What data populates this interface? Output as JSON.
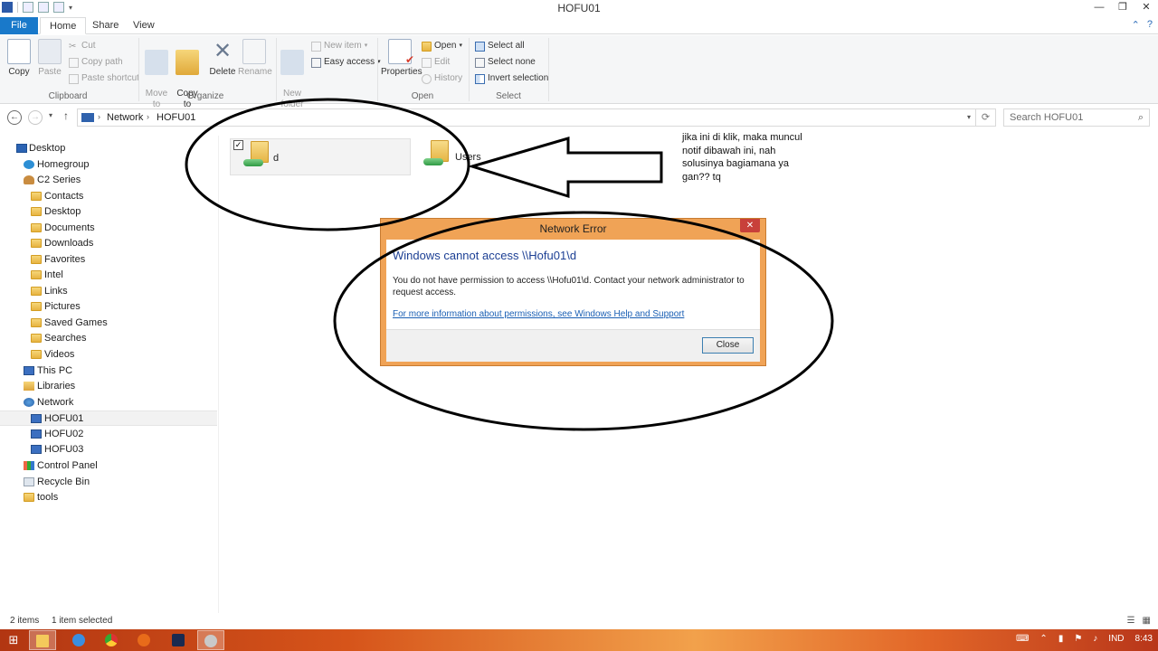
{
  "window": {
    "title": "HOFU01"
  },
  "ribbon_tabs": {
    "file": "File",
    "home": "Home",
    "share": "Share",
    "view": "View"
  },
  "ribbon": {
    "copy": "Copy",
    "paste": "Paste",
    "cut": "Cut",
    "copy_path": "Copy path",
    "paste_shortcut": "Paste shortcut",
    "clipboard_group": "Clipboard",
    "move_to": "Move\nto",
    "copy_to": "Copy\nto",
    "delete": "Delete",
    "rename": "Rename",
    "organize_group": "Organize",
    "new_folder": "New\nfolder",
    "new_item": "New item",
    "easy_access": "Easy access",
    "properties": "Properties",
    "open": "Open",
    "edit": "Edit",
    "history": "History",
    "open_group": "Open",
    "select_all": "Select all",
    "select_none": "Select none",
    "invert_selection": "Invert selection",
    "select_group": "Select"
  },
  "address": {
    "crumbs": [
      "Network",
      "HOFU01"
    ],
    "search_placeholder": "Search HOFU01"
  },
  "nav": {
    "items": [
      {
        "label": "Desktop",
        "icon": "desktop-icon"
      },
      {
        "label": "Homegroup",
        "icon": "homegroup-icon"
      },
      {
        "label": "C2 Series",
        "icon": "user-icon"
      },
      {
        "label": "Contacts",
        "icon": "folder-icon"
      },
      {
        "label": "Desktop",
        "icon": "folder-icon"
      },
      {
        "label": "Documents",
        "icon": "folder-icon"
      },
      {
        "label": "Downloads",
        "icon": "folder-icon"
      },
      {
        "label": "Favorites",
        "icon": "folder-icon"
      },
      {
        "label": "Intel",
        "icon": "folder-icon"
      },
      {
        "label": "Links",
        "icon": "folder-icon"
      },
      {
        "label": "Pictures",
        "icon": "folder-icon"
      },
      {
        "label": "Saved Games",
        "icon": "folder-icon"
      },
      {
        "label": "Searches",
        "icon": "folder-icon"
      },
      {
        "label": "Videos",
        "icon": "folder-icon"
      },
      {
        "label": "This PC",
        "icon": "pc-icon"
      },
      {
        "label": "Libraries",
        "icon": "libraries-icon"
      },
      {
        "label": "Network",
        "icon": "network-icon"
      },
      {
        "label": "HOFU01",
        "icon": "computer-icon"
      },
      {
        "label": "HOFU02",
        "icon": "computer-icon"
      },
      {
        "label": "HOFU03",
        "icon": "computer-icon"
      },
      {
        "label": "Control Panel",
        "icon": "control-panel-icon"
      },
      {
        "label": "Recycle Bin",
        "icon": "recycle-bin-icon"
      },
      {
        "label": "tools",
        "icon": "folder-icon"
      }
    ]
  },
  "content": {
    "items": [
      {
        "name": "d",
        "selected": true
      },
      {
        "name": "Users",
        "selected": false
      }
    ]
  },
  "annotation": {
    "note": "jika ini di klik, maka muncul notif dibawah ini, nah solusinya bagiamana ya gan?? tq"
  },
  "dialog": {
    "title": "Network Error",
    "heading": "Windows cannot access \\\\Hofu01\\d",
    "message": "You do not have permission to access \\\\Hofu01\\d. Contact your network administrator to request access.",
    "link": "For more information about permissions, see Windows Help and Support",
    "close_button": "Close"
  },
  "status": {
    "count": "2 items",
    "selection": "1 item selected"
  },
  "taskbar": {
    "language": "IND",
    "time": "8:43"
  },
  "colors": {
    "accent": "#1979ca",
    "dialog_frame": "#f0a356",
    "link": "#1a5fb4"
  }
}
